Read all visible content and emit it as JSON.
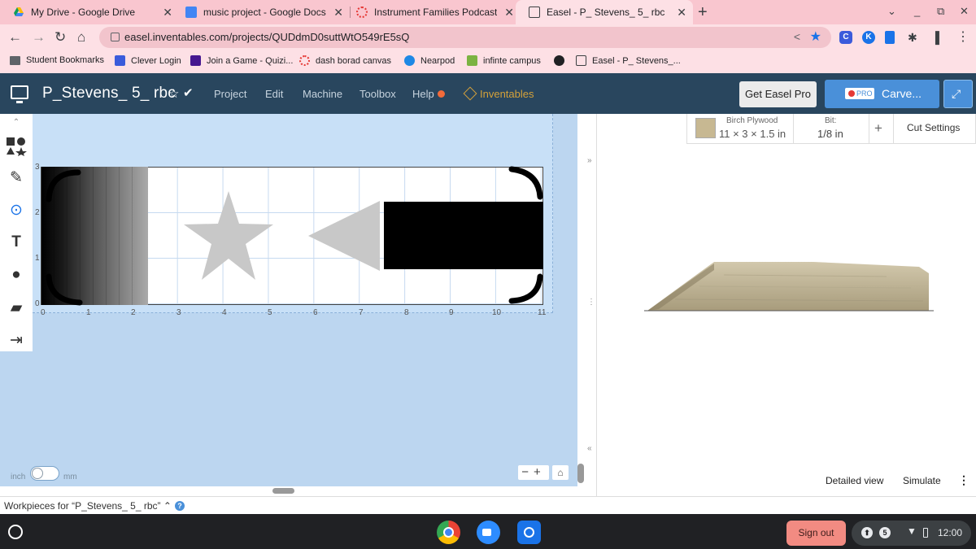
{
  "tabs": [
    {
      "title": "My Drive - Google Drive",
      "icon": "google-drive-icon"
    },
    {
      "title": "music project - Google Docs",
      "icon": "google-docs-icon"
    },
    {
      "title": "Instrument Families Podcast",
      "icon": "podcast-icon"
    },
    {
      "title": "Easel - P_ Stevens_ 5_ rbc",
      "icon": "easel-icon"
    }
  ],
  "address_bar": {
    "url": "easel.inventables.com/projects/QUDdmD0suttWtO549rE5sQ"
  },
  "bookmarks": [
    {
      "label": "Student Bookmarks",
      "icon": "folder-icon"
    },
    {
      "label": "Clever Login",
      "icon": "clever-icon"
    },
    {
      "label": "Join a Game - Quizi...",
      "icon": "quizizz-icon"
    },
    {
      "label": "dash borad canvas",
      "icon": "canvas-icon"
    },
    {
      "label": "Nearpod",
      "icon": "nearpod-icon"
    },
    {
      "label": "infinte campus",
      "icon": "campus-icon"
    },
    {
      "label": "",
      "icon": "globe-icon"
    },
    {
      "label": "Easel - P_ Stevens_...",
      "icon": "easel-icon"
    }
  ],
  "app": {
    "project_name": "P_Stevens_ 5_ rbc",
    "menu": [
      "Project",
      "Edit",
      "Machine",
      "Toolbox",
      "Help"
    ],
    "brand": "Inventables",
    "get_pro_label": "Get Easel Pro",
    "pro_badge": "PRO",
    "carve_label": "Carve..."
  },
  "canvas": {
    "x_ticks": [
      "0",
      "1",
      "2",
      "3",
      "4",
      "5",
      "6",
      "7",
      "8",
      "9",
      "10",
      "11"
    ],
    "y_ticks": [
      "3",
      "2",
      "1",
      "0"
    ]
  },
  "units": {
    "left": "inch",
    "right": "mm"
  },
  "material": {
    "name": "Birch Plywood",
    "size": "11 × 3 × 1.5 in",
    "bit_label": "Bit:",
    "bit_value": "1/8 in",
    "add_label": "+",
    "cut_settings_label": "Cut Settings"
  },
  "preview": {
    "detailed_view_label": "Detailed view",
    "simulate_label": "Simulate"
  },
  "workpieces_label": "Workpieces for “P_Stevens_ 5_ rbc”",
  "shelf": {
    "sign_out_label": "Sign out",
    "notification_count": "5",
    "time": "12:00"
  },
  "colors": {
    "header_bg": "#29465e",
    "carve_button": "#4a90d9",
    "tab_strip": "#f9c6cf",
    "sign_out_bg": "#f28b82"
  }
}
